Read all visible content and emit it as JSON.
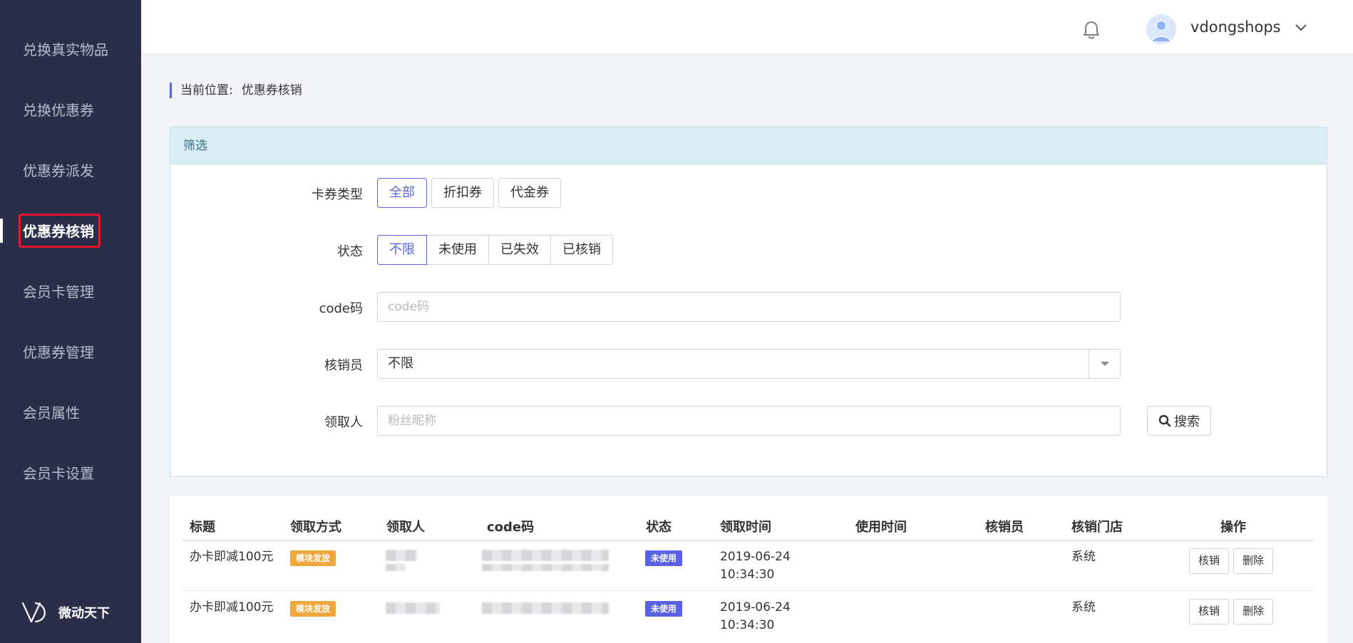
{
  "sidebar": {
    "items": [
      {
        "label": "兑换真实物品"
      },
      {
        "label": "兑换优惠券"
      },
      {
        "label": "优惠券派发"
      },
      {
        "label": "优惠券核销"
      },
      {
        "label": "会员卡管理"
      },
      {
        "label": "优惠券管理"
      },
      {
        "label": "会员属性"
      },
      {
        "label": "会员卡设置"
      }
    ],
    "brand": "微动天下"
  },
  "topbar": {
    "username": "vdongshops"
  },
  "breadcrumb": {
    "prefix": "当前位置:",
    "current": "优惠券核销"
  },
  "filter": {
    "title": "筛选",
    "card_type": {
      "label": "卡券类型",
      "options": [
        "全部",
        "折扣券",
        "代金券"
      ],
      "selected": "全部"
    },
    "status": {
      "label": "状态",
      "options": [
        "不限",
        "未使用",
        "已失效",
        "已核销"
      ],
      "selected": "不限"
    },
    "code": {
      "label": "code码",
      "placeholder": "code码",
      "value": ""
    },
    "verifier": {
      "label": "核销员",
      "value": "不限"
    },
    "receiver": {
      "label": "领取人",
      "placeholder": "粉丝昵称",
      "value": ""
    },
    "search_label": "搜索"
  },
  "table": {
    "headers": [
      "标题",
      "领取方式",
      "领取人",
      "code码",
      "状态",
      "领取时间",
      "使用时间",
      "核销员",
      "核销门店",
      "操作"
    ],
    "rows": [
      {
        "title": "办卡即减100元",
        "method": "模块发放",
        "status": "未使用",
        "receive_date": "2019-06-24",
        "receive_time": "10:34:30",
        "store": "系统",
        "verify_label": "核销",
        "delete_label": "删除"
      },
      {
        "title": "办卡即减100元",
        "method": "模块发放",
        "status": "未使用",
        "receive_date": "2019-06-24",
        "receive_time": "10:34:30",
        "store": "系统",
        "verify_label": "核销",
        "delete_label": "删除"
      }
    ]
  },
  "colors": {
    "sidebar_bg": "#2a2e48",
    "accent": "#5b68d8",
    "highlight_box": "#e3182d",
    "badge_orange": "#f0a83e",
    "badge_blue": "#5b62e2"
  }
}
